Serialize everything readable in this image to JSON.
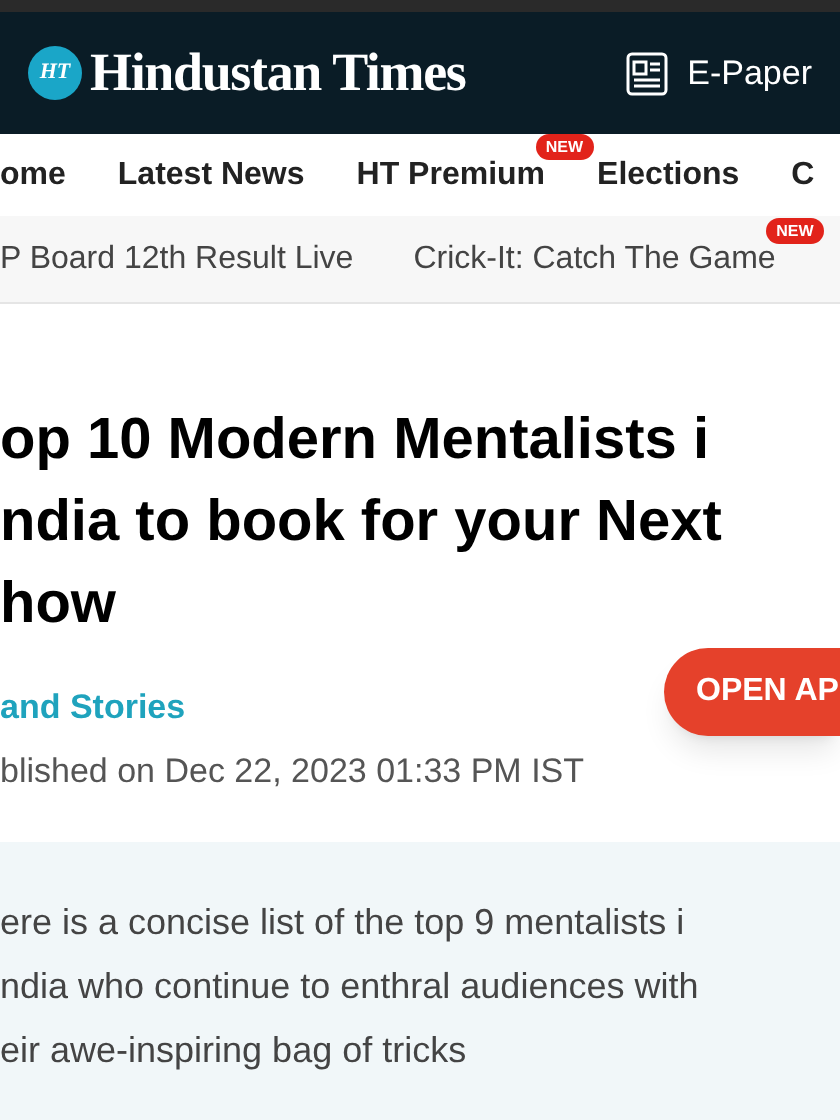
{
  "header": {
    "logo_mark": "HT",
    "logo_text": "Hindustan Times",
    "epaper": "E-Paper"
  },
  "nav": [
    {
      "label": "ome"
    },
    {
      "label": "Latest News"
    },
    {
      "label": "HT Premium",
      "badge": "NEW"
    },
    {
      "label": "Elections"
    },
    {
      "label": "C"
    }
  ],
  "trending": [
    {
      "label": "P Board 12th Result Live"
    },
    {
      "label": "Crick-It: Catch The Game",
      "badge": "NEW"
    }
  ],
  "article": {
    "title_lines": [
      "op 10 Modern Mentalists i",
      "ndia to book for your Next",
      "how"
    ],
    "open_app": "OPEN AP",
    "section": "and Stories",
    "published": "blished on Dec 22, 2023 01:33 PM IST",
    "summary_lines": [
      "ere is a concise list of the top 9 mentalists i",
      "ndia who continue to enthral audiences with",
      "eir awe-inspiring bag of tricks"
    ]
  }
}
